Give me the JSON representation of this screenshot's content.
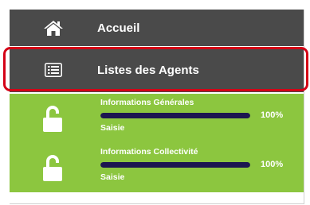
{
  "menu": {
    "home": {
      "label": "Accueil",
      "icon": "home-icon"
    },
    "agents": {
      "label": "Listes des Agents",
      "icon": "list-icon"
    },
    "progress": [
      {
        "title": "Informations Générales",
        "percent_label": "100%",
        "progress": 1.0,
        "status": "Saisie",
        "icon": "unlocked-lock-icon"
      },
      {
        "title": "Informations Collectivité",
        "percent_label": "100%",
        "progress": 1.0,
        "status": "Saisie",
        "icon": "unlocked-lock-icon"
      }
    ]
  },
  "colors": {
    "menu_bg": "#4a4a4a",
    "progress_bg": "#8cc63f",
    "progress_fill": "#1c1650",
    "highlight": "#d40016"
  }
}
